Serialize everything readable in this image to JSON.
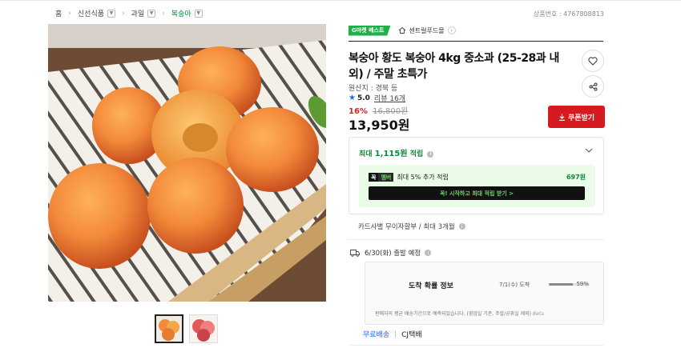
{
  "breadcrumb": [
    {
      "label": "홈",
      "dropdown": false
    },
    {
      "label": "신선식품",
      "dropdown": true
    },
    {
      "label": "과일",
      "dropdown": true
    },
    {
      "label": "복숭아",
      "dropdown": true
    }
  ],
  "product_number": "상품번호 : 4767808813",
  "badge": "G마켓 베스트",
  "store": {
    "name": "센트럴푸드몰"
  },
  "title": "복숭아 황도 복숭아 4kg 중소과 (25-28과 내외) / 주말 초특가",
  "origin": "원산지 : 경북 등",
  "rating": {
    "score": "5.0",
    "review_label": "리뷰 16개"
  },
  "price": {
    "discount": "16%",
    "original": "16,800원",
    "sale": "13,950원"
  },
  "buttons": {
    "coupon": "쿠폰받기"
  },
  "points": {
    "prefix": "최대",
    "amount": "1,115원",
    "suffix": "적립",
    "member_logo_k": "꼭",
    "member_logo_m": "멤버",
    "member_text": "최대 5% 추가 적립",
    "member_amount": "697원",
    "member_cta": "꼭! 시작하고 최대 적립 받기 >"
  },
  "installment": "카드사별 무이자할부 / 최대 3개월",
  "shipping": {
    "departure": "6/30(화) 출발 예정",
    "probability_title": "도착 확률 정보",
    "probability_date": "7/1(수) 도착",
    "probability_value": 59,
    "probability_pct": "59%",
    "note": "판매자의 평균 배송기간으로 예측되었습니다. (영업일 기준, 주말/공휴일 제외)",
    "beta": "Beta",
    "free_label": "무료배송",
    "courier": "CJ택배"
  },
  "colors": {
    "accent_green": "#0a8a3c",
    "badge_green": "#1fb04a",
    "coupon_red": "#d71920",
    "discount_red": "#e02020",
    "link_blue": "#2266dd"
  },
  "icons": [
    "home-icon",
    "heart-icon",
    "share-icon",
    "download-icon",
    "star-icon",
    "chevron-down-icon",
    "truck-icon",
    "info-icon"
  ]
}
